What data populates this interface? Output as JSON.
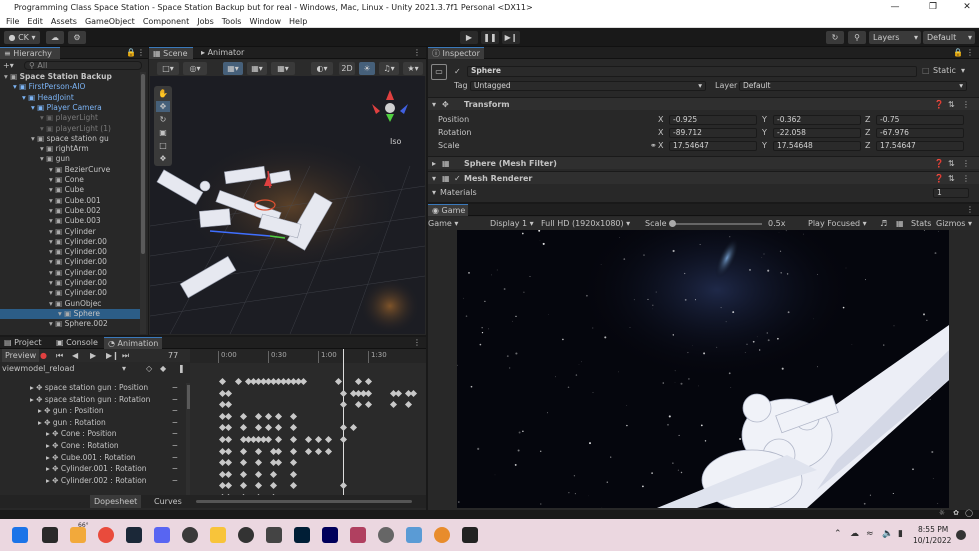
{
  "window": {
    "title": "Programming Class Space Station - Space Station Backup but for real - Windows, Mac, Linux - Unity 2021.3.7f1 Personal <DX11>"
  },
  "menu": [
    "File",
    "Edit",
    "Assets",
    "GameObject",
    "Component",
    "Jobs",
    "Tools",
    "Window",
    "Help"
  ],
  "toolbar": {
    "account": "CK",
    "layers": "Layers",
    "layout": "Default"
  },
  "hierarchy": {
    "tab": "Hierarchy",
    "search_placeholder": "All",
    "items": [
      {
        "label": "Space Station Backup",
        "indent": 0,
        "style": "bold"
      },
      {
        "label": "FirstPerson-AIO",
        "indent": 1,
        "style": "blue"
      },
      {
        "label": "HeadJoint",
        "indent": 2,
        "style": "blue"
      },
      {
        "label": "Player Camera",
        "indent": 3,
        "style": "blue"
      },
      {
        "label": "playerLight",
        "indent": 4,
        "style": "gray"
      },
      {
        "label": "playerLight (1)",
        "indent": 4,
        "style": "gray"
      },
      {
        "label": "space station gu",
        "indent": 3,
        "style": "normal"
      },
      {
        "label": "rightArm",
        "indent": 4,
        "style": "normal"
      },
      {
        "label": "gun",
        "indent": 4,
        "style": "normal"
      },
      {
        "label": "BezierCurve",
        "indent": 5,
        "style": "normal"
      },
      {
        "label": "Cone",
        "indent": 5,
        "style": "normal"
      },
      {
        "label": "Cube",
        "indent": 5,
        "style": "normal"
      },
      {
        "label": "Cube.001",
        "indent": 5,
        "style": "normal"
      },
      {
        "label": "Cube.002",
        "indent": 5,
        "style": "normal"
      },
      {
        "label": "Cube.003",
        "indent": 5,
        "style": "normal"
      },
      {
        "label": "Cylinder",
        "indent": 5,
        "style": "normal"
      },
      {
        "label": "Cylinder.00",
        "indent": 5,
        "style": "normal"
      },
      {
        "label": "Cylinder.00",
        "indent": 5,
        "style": "normal"
      },
      {
        "label": "Cylinder.00",
        "indent": 5,
        "style": "normal"
      },
      {
        "label": "Cylinder.00",
        "indent": 5,
        "style": "normal"
      },
      {
        "label": "Cylinder.00",
        "indent": 5,
        "style": "normal"
      },
      {
        "label": "Cylinder.00",
        "indent": 5,
        "style": "normal"
      },
      {
        "label": "GunObjec",
        "indent": 5,
        "style": "normal"
      },
      {
        "label": "Sphere",
        "indent": 6,
        "style": "selected"
      },
      {
        "label": "Sphere.002",
        "indent": 5,
        "style": "normal"
      }
    ]
  },
  "scene": {
    "tab": "Scene",
    "tab2": "Animator",
    "mode_2d": "2D",
    "view_label": "Iso"
  },
  "inspector": {
    "tab": "Inspector",
    "object_name": "Sphere",
    "static_label": "Static",
    "tag_label": "Tag",
    "tag_value": "Untagged",
    "layer_label": "Layer",
    "layer_value": "Default",
    "transform": {
      "title": "Transform",
      "position_label": "Position",
      "rotation_label": "Rotation",
      "scale_label": "Scale",
      "position": {
        "x": "-0.925",
        "y": "-0.362",
        "z": "-0.75"
      },
      "rotation": {
        "x": "-89.712",
        "y": "-22.058",
        "z": "-67.976"
      },
      "scale": {
        "x": "17.54647",
        "y": "17.54648",
        "z": "17.54647"
      }
    },
    "mesh_filter": "Sphere (Mesh Filter)",
    "mesh_renderer": "Mesh Renderer",
    "materials_label": "Materials",
    "materials_count": "1"
  },
  "game": {
    "tab": "Game",
    "mode": "Game",
    "display": "Display 1",
    "resolution": "Full HD (1920x1080)",
    "scale_label": "Scale",
    "scale_value": "0.5x",
    "play_mode": "Play Focused",
    "stats": "Stats",
    "gizmos": "Gizmos"
  },
  "bottom": {
    "tabs": [
      "Project",
      "Console",
      "Animation"
    ],
    "preview": "Preview",
    "frame": "77",
    "clip": "viewmodel_reload",
    "timeline_marks": [
      "0:00",
      "0:30",
      "1:00",
      "1:30"
    ],
    "properties": [
      "space station gun : Position",
      "space station gun : Rotation",
      "gun : Position",
      "gun : Rotation",
      "Cone : Position",
      "Cone : Rotation",
      "Cube.001 : Rotation",
      "Cylinder.001 : Rotation",
      "Cylinder.002 : Rotation"
    ],
    "dopesheet": "Dopesheet",
    "curves": "Curves"
  },
  "taskbar": {
    "time": "8:55 PM",
    "date": "10/1/2022",
    "weather": "66°"
  }
}
